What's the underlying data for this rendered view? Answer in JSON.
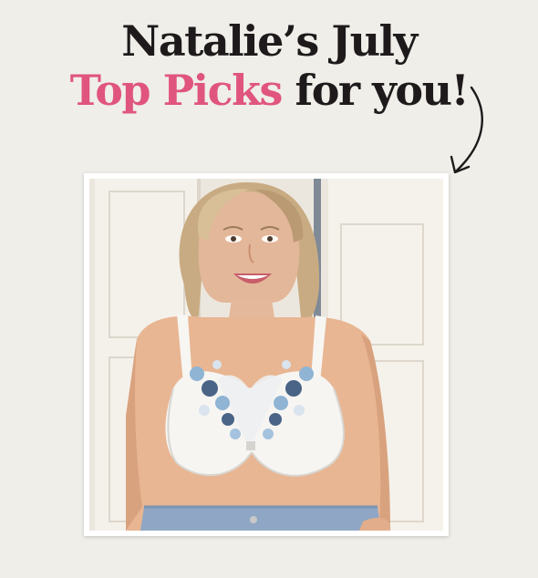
{
  "headline": {
    "line1": "Natalie’s July",
    "line2_accent": "Top Picks",
    "line2_rest": " for you!"
  },
  "colors": {
    "background": "#efeee9",
    "text": "#1e1a1b",
    "accent": "#e0557d",
    "frame": "#ffffff"
  },
  "arrow": {
    "icon": "curved-arrow-down-icon"
  },
  "photo": {
    "subject": "woman-in-white-embroidered-bra"
  }
}
